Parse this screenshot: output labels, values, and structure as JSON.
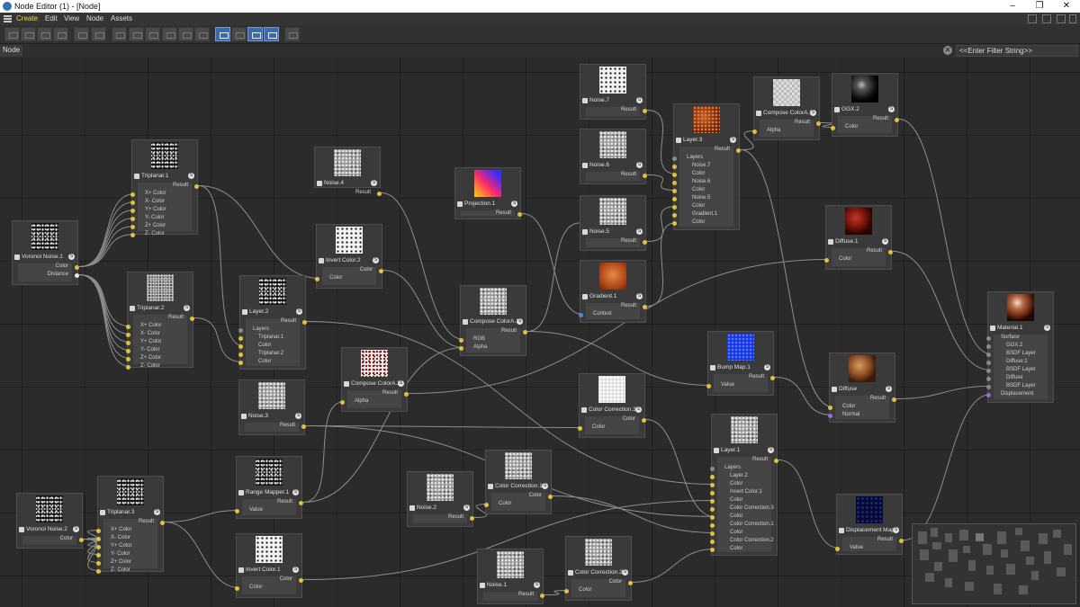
{
  "window": {
    "title": "Node Editor (1) - [Node]",
    "min": "–",
    "max": "❐",
    "close": "✕"
  },
  "menu": [
    "Create",
    "Edit",
    "View",
    "Node",
    "Assets"
  ],
  "pathbar": {
    "crumb": "Node",
    "filter_placeholder": "<<Enter Filter String>>"
  },
  "colors": {
    "yellow_port": "#e0c23e",
    "blue_port": "#5b84d6",
    "green_port": "#3fcf8f",
    "purple_port": "#9c66d6",
    "grey_port": "#8a8a8a",
    "white_port": "#e8e8e8",
    "wire": "#8d8d8d"
  },
  "nodes": [
    {
      "id": "voronoi1",
      "label": "Voronoi Noise.1",
      "preview": "specks",
      "outputs": [
        "Color",
        "Distance"
      ],
      "inputs": []
    },
    {
      "id": "triplanar1",
      "label": "Triplanar.1",
      "preview": "specks",
      "outputs": [
        "Result"
      ],
      "inputs": [
        "X+ Color",
        "X- Color",
        "Y+ Color",
        "Y- Color",
        "Z+ Color",
        "Z- Color"
      ]
    },
    {
      "id": "triplanar2",
      "label": "Triplanar.2",
      "preview": "noisy",
      "outputs": [
        "Result"
      ],
      "inputs": [
        "X+ Color",
        "X- Color",
        "Y+ Color",
        "Y- Color",
        "Z+ Color",
        "Z- Color"
      ]
    },
    {
      "id": "noise4",
      "label": "Noise.4",
      "preview": "noise",
      "outputs": [
        "Result"
      ],
      "inputs": []
    },
    {
      "id": "invert2",
      "label": "Invert Color.2",
      "preview": "invert",
      "outputs": [
        "Color"
      ],
      "inputs": [
        "Color"
      ]
    },
    {
      "id": "layer2",
      "label": "Layer.2",
      "preview": "specks",
      "outputs": [
        "Result"
      ],
      "inputs": [
        "Layers",
        "Triplanar.1",
        "Color",
        "Triplanar.2",
        "Color"
      ]
    },
    {
      "id": "projection1",
      "label": "Projection.1",
      "preview": "projection",
      "outputs": [
        "Result"
      ],
      "inputs": []
    },
    {
      "id": "composeA1",
      "label": "Compose ColorA.1",
      "preview": "noise",
      "outputs": [
        "Result"
      ],
      "inputs": [
        "RGB",
        "Alpha"
      ]
    },
    {
      "id": "composeA2",
      "label": "Compose ColorA.2",
      "preview": "reddots",
      "outputs": [
        "Result"
      ],
      "inputs": [
        "Alpha"
      ]
    },
    {
      "id": "noise3",
      "label": "Noise.3",
      "preview": "noise",
      "outputs": [
        "Result"
      ],
      "inputs": []
    },
    {
      "id": "noise7",
      "label": "Noise.7",
      "preview": "invert",
      "outputs": [
        "Result"
      ],
      "inputs": []
    },
    {
      "id": "noise6",
      "label": "Noise.6",
      "preview": "noise",
      "outputs": [
        "Result"
      ],
      "inputs": []
    },
    {
      "id": "noise5",
      "label": "Noise.5",
      "preview": "noise",
      "outputs": [
        "Result"
      ],
      "inputs": []
    },
    {
      "id": "gradient1",
      "label": "Gradient.1",
      "preview": "gradient",
      "outputs": [
        "Result"
      ],
      "inputs": [
        "Context"
      ]
    },
    {
      "id": "layer3",
      "label": "Layer.3",
      "preview": "rust",
      "outputs": [
        "Result"
      ],
      "inputs": [
        "Layers",
        "Noise.7",
        "Color",
        "Noise.6",
        "Color",
        "Noise.5",
        "Color",
        "Gradient.1",
        "Color"
      ]
    },
    {
      "id": "composeA3",
      "label": "Compose ColorA.3",
      "preview": "checker",
      "outputs": [
        "Result"
      ],
      "inputs": [
        "Alpha"
      ]
    },
    {
      "id": "ggx2",
      "label": "GGX.2",
      "preview": "ballblack",
      "outputs": [
        "Result"
      ],
      "inputs": [
        "Color"
      ]
    },
    {
      "id": "diffuse1",
      "label": "Diffuse.1",
      "preview": "ballred",
      "outputs": [
        "Result"
      ],
      "inputs": [
        "Color"
      ]
    },
    {
      "id": "bumpmap1",
      "label": "Bump Map.1",
      "preview": "blue",
      "outputs": [
        "Result"
      ],
      "inputs": [
        "Value"
      ]
    },
    {
      "id": "colorcorr3",
      "label": "Color Correction.3",
      "preview": "lightnoise",
      "outputs": [
        "Color"
      ],
      "inputs": [
        "Color"
      ]
    },
    {
      "id": "diffuse",
      "label": "Diffuse",
      "preview": "ballbrown",
      "outputs": [
        "Result"
      ],
      "inputs": [
        "Color",
        "Normal"
      ]
    },
    {
      "id": "material1",
      "label": "Material.1",
      "preview": "ballcopper",
      "outputs": [],
      "inputs": [
        "Surface",
        "GGX.2",
        "BSDF Layer",
        "Diffuse.1",
        "BSDF Layer",
        "Diffuse",
        "BSDF Layer",
        "Displacement"
      ]
    },
    {
      "id": "layer1",
      "label": "Layer.1",
      "preview": "noise",
      "outputs": [
        "Result"
      ],
      "inputs": [
        "Layers",
        "Layer.2",
        "Color",
        "Invert Color.1",
        "Color",
        "Color Correction.3",
        "Color",
        "Color Correction.1",
        "Color",
        "Color Correction.2",
        "Color"
      ]
    },
    {
      "id": "displace1",
      "label": "Displacement Map.1",
      "preview": "darkblue",
      "outputs": [
        "Result"
      ],
      "inputs": [
        "Value"
      ]
    },
    {
      "id": "noise2",
      "label": "Noise.2",
      "preview": "noise",
      "outputs": [
        "Result"
      ],
      "inputs": []
    },
    {
      "id": "colorcorr1",
      "label": "Color Correction.1",
      "preview": "noise",
      "outputs": [
        "Color"
      ],
      "inputs": [
        "Color"
      ]
    },
    {
      "id": "rangemapper1",
      "label": "Range Mapper.1",
      "preview": "specks",
      "outputs": [
        "Result"
      ],
      "inputs": [
        "Value"
      ]
    },
    {
      "id": "voronoi2",
      "label": "Voronoi Noise.2",
      "preview": "specks",
      "outputs": [
        "Color"
      ],
      "inputs": []
    },
    {
      "id": "triplanar3",
      "label": "Triplanar.3",
      "preview": "specks",
      "outputs": [
        "Result"
      ],
      "inputs": [
        "X+ Color",
        "X- Color",
        "Y+ Color",
        "Y- Color",
        "Z+ Color",
        "Z- Color"
      ]
    },
    {
      "id": "invert1",
      "label": "Invert Color.1",
      "preview": "invert",
      "outputs": [
        "Color"
      ],
      "inputs": [
        "Color"
      ]
    },
    {
      "id": "noise1",
      "label": "Noise.1",
      "preview": "noise",
      "outputs": [
        "Result"
      ],
      "inputs": []
    },
    {
      "id": "colorcorr2",
      "label": "Color Correction.2",
      "preview": "noise",
      "outputs": [
        "Color"
      ],
      "inputs": [
        "Color"
      ]
    }
  ],
  "wires": [
    [
      "voronoi1",
      0,
      "triplanar1",
      0
    ],
    [
      "voronoi1",
      0,
      "triplanar1",
      1
    ],
    [
      "voronoi1",
      0,
      "triplanar1",
      2
    ],
    [
      "voronoi1",
      0,
      "triplanar1",
      3
    ],
    [
      "voronoi1",
      0,
      "triplanar1",
      4
    ],
    [
      "voronoi1",
      0,
      "triplanar1",
      5
    ],
    [
      "voronoi1",
      1,
      "triplanar2",
      0
    ],
    [
      "voronoi1",
      1,
      "triplanar2",
      1
    ],
    [
      "voronoi1",
      1,
      "triplanar2",
      2
    ],
    [
      "voronoi1",
      1,
      "triplanar2",
      3
    ],
    [
      "voronoi1",
      1,
      "triplanar2",
      4
    ],
    [
      "voronoi1",
      1,
      "triplanar2",
      5
    ],
    [
      "triplanar1",
      0,
      "layer2",
      2
    ],
    [
      "triplanar2",
      0,
      "layer2",
      4
    ],
    [
      "triplanar1",
      0,
      "invert2",
      0
    ],
    [
      "noise4",
      0,
      "composeA1",
      0
    ],
    [
      "invert2",
      0,
      "composeA1",
      1
    ],
    [
      "layer2",
      0,
      "layer1",
      2
    ],
    [
      "projection1",
      0,
      "gradient1",
      0
    ],
    [
      "composeA1",
      0,
      "bumpmap1",
      0
    ],
    [
      "composeA1",
      0,
      "noise5",
      -1
    ],
    [
      "composeA2",
      0,
      "diffuse1",
      0
    ],
    [
      "noise3",
      0,
      "colorcorr3",
      0
    ],
    [
      "noise7",
      0,
      "layer3",
      2
    ],
    [
      "noise6",
      0,
      "layer3",
      4
    ],
    [
      "noise5",
      0,
      "layer3",
      6
    ],
    [
      "gradient1",
      0,
      "layer3",
      8
    ],
    [
      "layer3",
      0,
      "composeA3",
      0
    ],
    [
      "composeA3",
      0,
      "ggx2",
      0
    ],
    [
      "layer3",
      0,
      "diffuse",
      0
    ],
    [
      "ggx2",
      0,
      "material1",
      2
    ],
    [
      "diffuse1",
      0,
      "material1",
      4
    ],
    [
      "diffuse",
      0,
      "material1",
      6
    ],
    [
      "bumpmap1",
      0,
      "diffuse",
      1
    ],
    [
      "displace1",
      0,
      "material1",
      7
    ],
    [
      "colorcorr3",
      0,
      "layer1",
      6
    ],
    [
      "layer1",
      0,
      "displace1",
      0
    ],
    [
      "noise2",
      0,
      "colorcorr1",
      0
    ],
    [
      "colorcorr1",
      0,
      "layer1",
      8
    ],
    [
      "rangemapper1",
      0,
      "composeA2",
      0
    ],
    [
      "rangemapper1",
      0,
      "composeA1",
      1
    ],
    [
      "voronoi2",
      0,
      "triplanar3",
      0
    ],
    [
      "voronoi2",
      0,
      "triplanar3",
      1
    ],
    [
      "voronoi2",
      0,
      "triplanar3",
      2
    ],
    [
      "voronoi2",
      0,
      "triplanar3",
      3
    ],
    [
      "voronoi2",
      0,
      "triplanar3",
      4
    ],
    [
      "voronoi2",
      0,
      "triplanar3",
      5
    ],
    [
      "triplanar3",
      0,
      "rangemapper1",
      0
    ],
    [
      "triplanar3",
      0,
      "invert1",
      0
    ],
    [
      "invert1",
      0,
      "layer1",
      4
    ],
    [
      "noise1",
      0,
      "colorcorr2",
      0
    ],
    [
      "colorcorr2",
      0,
      "layer1",
      10
    ],
    [
      "noise3",
      0,
      "layer1",
      6
    ]
  ]
}
